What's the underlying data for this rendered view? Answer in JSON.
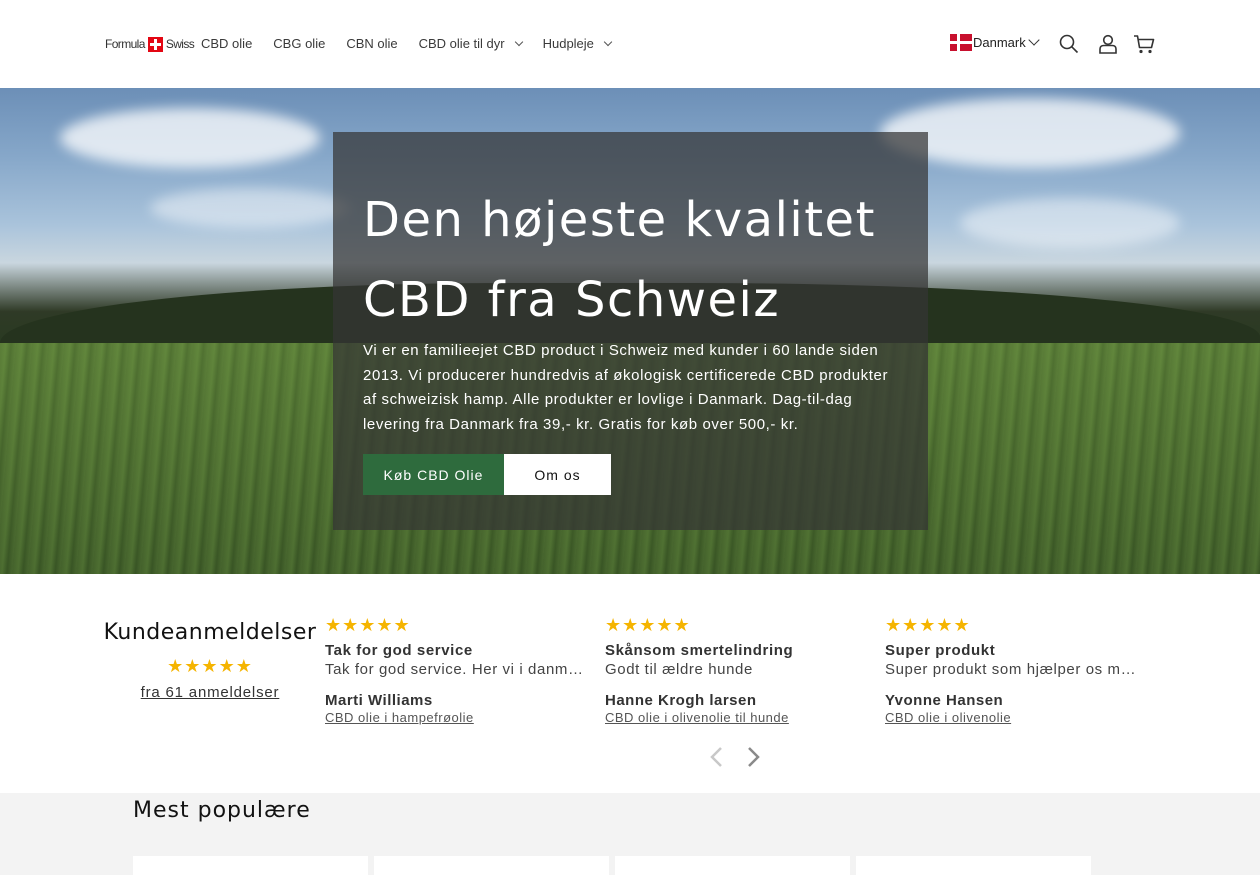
{
  "header": {
    "logo_left": "Formula",
    "logo_right": "Swiss",
    "nav": [
      {
        "label": "CBD olie"
      },
      {
        "label": "CBG olie"
      },
      {
        "label": "CBN olie"
      },
      {
        "label": "CBD olie til dyr"
      },
      {
        "label": "Hudpleje"
      }
    ],
    "country": "Danmark",
    "icons": [
      "search-icon",
      "account-icon",
      "cart-icon"
    ]
  },
  "hero": {
    "title": "Den højeste kvalitet CBD fra Schweiz",
    "text": "Vi er en familieejet CBD product i Schweiz med kunder i 60 lande siden 2013. Vi producerer hundredvis af økologisk certificerede CBD produkter af schweizisk hamp. Alle produkter er lovlige i Danmark. Dag-til-dag levering fra Danmark fra 39,- kr. Gratis for køb over 500,- kr.",
    "primary_button": "Køb CBD Olie",
    "secondary_button": "Om os"
  },
  "reviews": {
    "heading": "Kundeanmeldelser",
    "stars": "★★★★★",
    "count_link": "fra 61 anmeldelser",
    "items": [
      {
        "stars": "★★★★★",
        "title": "Tak for god service",
        "body": "Tak for god service. Her vi i danmark…",
        "author": "Marti Williams",
        "product": "CBD olie i hampefrøolie"
      },
      {
        "stars": "★★★★★",
        "title": "Skånsom smertelindring",
        "body": "Godt til ældre hunde",
        "author": "Hanne Krogh larsen",
        "product": "CBD olie i olivenolie til hunde"
      },
      {
        "stars": "★★★★★",
        "title": "Super produkt",
        "body": "Super produkt som hjælper os mod…",
        "author": "Yvonne Hansen",
        "product": "CBD olie i olivenolie"
      }
    ]
  },
  "popular": {
    "heading": "Mest populære"
  },
  "colors": {
    "accent_green": "#2e6b3d",
    "star_yellow": "#f5b400",
    "flag_red": "#c8102e"
  }
}
